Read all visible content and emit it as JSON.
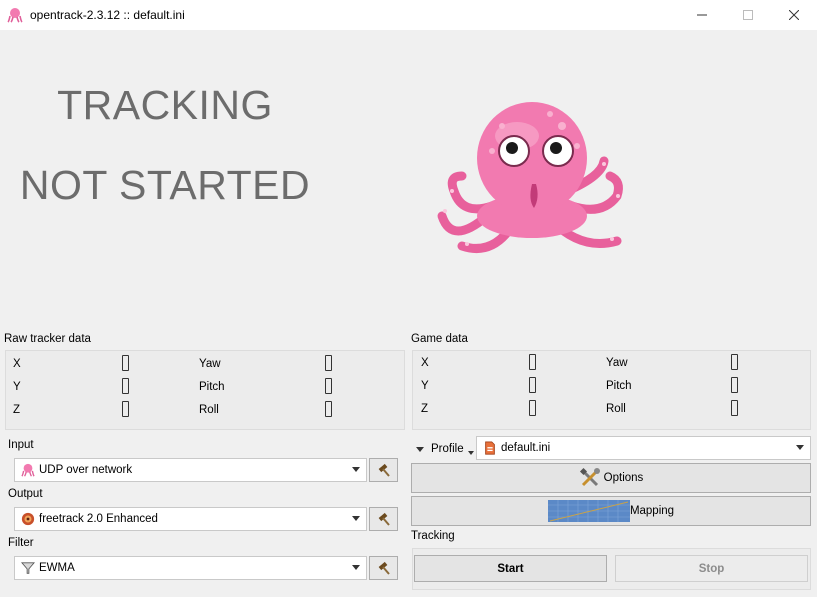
{
  "window": {
    "title": "opentrack-2.3.12 :: default.ini",
    "minimize_icon": "minimize-icon",
    "maximize_icon": "maximize-icon",
    "close_icon": "close-icon"
  },
  "status": {
    "line1": "TRACKING",
    "line2": "NOT STARTED"
  },
  "raw_tracker": {
    "label": "Raw tracker data",
    "x_label": "X",
    "y_label": "Y",
    "z_label": "Z",
    "yaw_label": "Yaw",
    "pitch_label": "Pitch",
    "roll_label": "Roll",
    "x_value": "0",
    "y_value": "0",
    "z_value": "0",
    "yaw_value": "0",
    "pitch_value": "0",
    "roll_value": "0"
  },
  "game_data": {
    "label": "Game data",
    "x_label": "X",
    "y_label": "Y",
    "z_label": "Z",
    "yaw_label": "Yaw",
    "pitch_label": "Pitch",
    "roll_label": "Roll",
    "x_value": "0",
    "y_value": "0",
    "z_value": "0",
    "yaw_value": "0",
    "pitch_value": "0",
    "roll_value": "0"
  },
  "input": {
    "label": "Input",
    "selected": "UDP over network",
    "icon": "udp-octopus-icon"
  },
  "output": {
    "label": "Output",
    "selected": "freetrack 2.0 Enhanced",
    "icon": "freetrack-icon"
  },
  "filter": {
    "label": "Filter",
    "selected": "EWMA",
    "icon": "funnel-icon"
  },
  "profile": {
    "label": "Profile",
    "selected": "default.ini",
    "icon": "ini-file-icon"
  },
  "options_button": {
    "label": "Options",
    "icon": "tools-icon"
  },
  "mapping_button": {
    "label": "Mapping",
    "icon": "curve-graph-icon"
  },
  "tracking": {
    "label": "Tracking",
    "start_label": "Start",
    "stop_label": "Stop"
  },
  "colors": {
    "status_text": "#6c6c6c",
    "octopus_pink": "#f27ab0",
    "window_bg": "#f0f0f0"
  }
}
